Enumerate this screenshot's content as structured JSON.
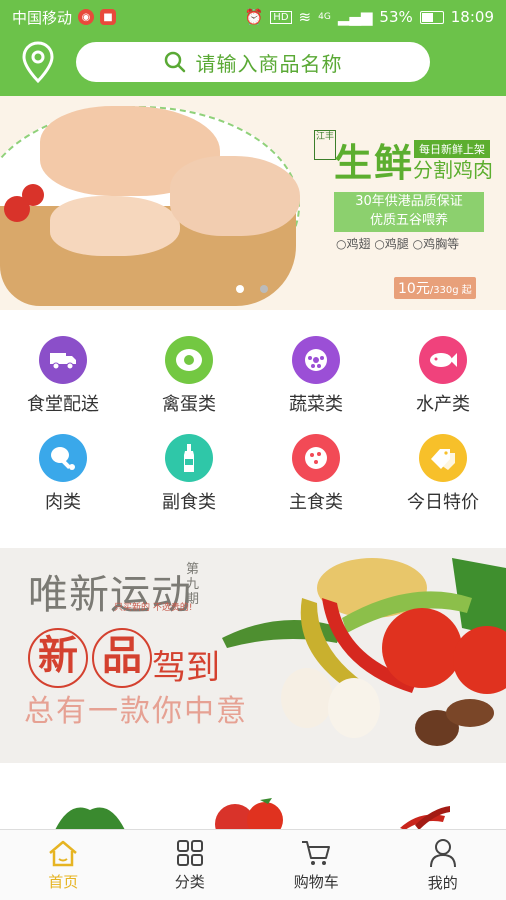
{
  "status_bar": {
    "carrier": "中国移动",
    "network": "4G",
    "battery": "53%",
    "time": "18:09"
  },
  "header": {
    "location_icon": "location-pin-icon",
    "search_placeholder": "请输入商品名称"
  },
  "banner_top": {
    "brand": "江丰",
    "title": "生鲜",
    "tag": "每日新鲜上架",
    "subtitle": "分割鸡肉",
    "promise_line1": "30年供港品质保证",
    "promise_line2": "优质五谷喂养",
    "cuts": [
      "鸡翅",
      "鸡腿",
      "鸡胸等"
    ],
    "price": "10元",
    "price_unit": "/330g 起",
    "page_count": 2,
    "active_page": 1
  },
  "categories": [
    {
      "label": "食堂配送",
      "icon": "truck-icon",
      "color": "#8b4fc9"
    },
    {
      "label": "禽蛋类",
      "icon": "egg-icon",
      "color": "#73c842"
    },
    {
      "label": "蔬菜类",
      "icon": "lotus-root-icon",
      "color": "#9b4fd6"
    },
    {
      "label": "水产类",
      "icon": "fish-icon",
      "color": "#f0427c"
    },
    {
      "label": "肉类",
      "icon": "ham-leg-icon",
      "color": "#3aa8ea"
    },
    {
      "label": "副食类",
      "icon": "bottle-icon",
      "color": "#2fc7a8"
    },
    {
      "label": "主食类",
      "icon": "pizza-icon",
      "color": "#f24a56"
    },
    {
      "label": "今日特价",
      "icon": "price-tag-icon",
      "color": "#f7c02a"
    }
  ],
  "banner_promo": {
    "title": "唯新运动",
    "issue": "第九期",
    "small_text": "只买新的 不选贵的!",
    "new_chars": [
      "新",
      "品"
    ],
    "arrive": "驾到",
    "slogan": "总有一款你中意"
  },
  "tab_bar": [
    {
      "label": "首页",
      "icon": "home-icon",
      "active": true
    },
    {
      "label": "分类",
      "icon": "grid-icon",
      "active": false
    },
    {
      "label": "购物车",
      "icon": "cart-icon",
      "active": false
    },
    {
      "label": "我的",
      "icon": "user-icon",
      "active": false
    }
  ],
  "colors": {
    "primary_green": "#6cc24a",
    "active_tab": "#e6b422",
    "promo_red": "#d4412f"
  }
}
